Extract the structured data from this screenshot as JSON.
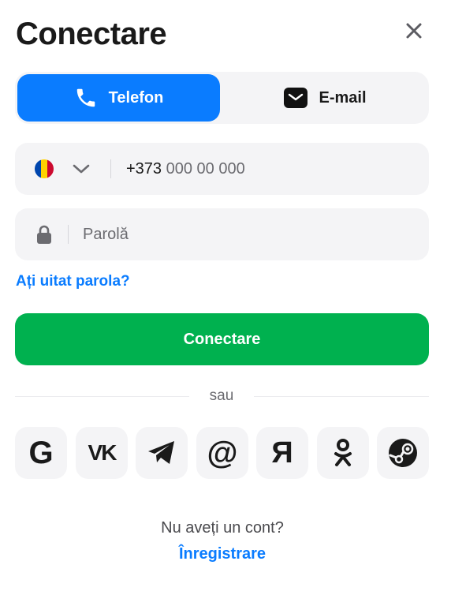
{
  "dialog": {
    "title": "Conectare",
    "close_icon": "close-icon"
  },
  "tabs": [
    {
      "label": "Telefon",
      "icon": "phone-icon",
      "active": true
    },
    {
      "label": "E-mail",
      "icon": "mail-icon",
      "active": false
    }
  ],
  "phone": {
    "country_flag": "moldova-flag-icon",
    "prefix": "+373",
    "placeholder": "000 00 000"
  },
  "password": {
    "placeholder": "Parolă",
    "icon": "lock-icon"
  },
  "forgot_label": "Ați uitat parola?",
  "submit_label": "Conectare",
  "divider_label": "sau",
  "social": [
    {
      "name": "google",
      "glyph": "G"
    },
    {
      "name": "vk",
      "glyph": "VK"
    },
    {
      "name": "telegram",
      "glyph": "telegram-icon"
    },
    {
      "name": "mail-ru",
      "glyph": "@"
    },
    {
      "name": "yandex",
      "glyph": "Я"
    },
    {
      "name": "odnoklassniki",
      "glyph": "odnoklassniki-icon"
    },
    {
      "name": "steam",
      "glyph": "steam-icon"
    }
  ],
  "footer": {
    "no_account": "Nu aveți un cont?",
    "register_label": "Înregistrare"
  },
  "colors": {
    "accent": "#0a7cff",
    "submit": "#00b14f",
    "field_bg": "#f4f4f6",
    "text": "#1a1a1a",
    "muted": "#6b6b70"
  }
}
